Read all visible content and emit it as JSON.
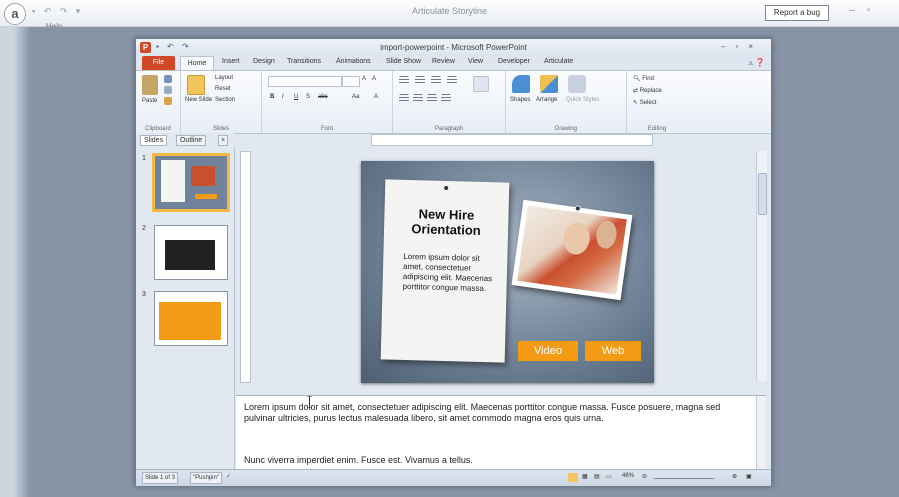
{
  "outer": {
    "title": "Articulate Storyline",
    "report_bug": "Report a bug",
    "help": "Help",
    "app_orb": "a"
  },
  "ppt": {
    "title": "import-powerpoint - Microsoft PowerPoint",
    "tabs": [
      "File",
      "Home",
      "Insert",
      "Design",
      "Transitions",
      "Animations",
      "Slide Show",
      "Review",
      "View",
      "Developer",
      "Articulate"
    ],
    "ribbon": {
      "clipboard": {
        "label": "Clipboard",
        "paste": "Paste"
      },
      "slides": {
        "label": "Slides",
        "new_slide": "New Slide",
        "layout": "Layout",
        "reset": "Reset",
        "section": "Section"
      },
      "font": {
        "label": "Font",
        "bold": "B",
        "italic": "I",
        "underline": "U",
        "strike": "S",
        "abc": "abc",
        "size_up": "A",
        "size_down": "A",
        "case": "Aa",
        "clear": "A"
      },
      "paragraph": {
        "label": "Paragraph"
      },
      "drawing": {
        "label": "Drawing",
        "shapes": "Shapes",
        "arrange": "Arrange",
        "quick_styles": "Quick Styles"
      },
      "editing": {
        "label": "Editing",
        "find": "Find",
        "replace": "Replace",
        "select": "Select"
      }
    },
    "panel_tabs": {
      "slides": "Slides",
      "outline": "Outline"
    },
    "thumbs": [
      "1",
      "2",
      "3"
    ],
    "slide": {
      "title_line1": "New Hire",
      "title_line2": "Orientation",
      "body": "Lorem ipsum dolor sit amet, consectetuer adipiscing elit. Maecenas porttitor congue massa.",
      "btn_video": "Video",
      "btn_web": "Web"
    },
    "notes": {
      "para1": "Lorem ipsum dolor sit amet, consectetuer adipiscing elit. Maecenas porttitor congue massa. Fusce posuere, magna sed pulvinar ultricies, purus lectus malesuada libero, sit amet commodo magna eros quis urna.",
      "para2": "Nunc viverra imperdiet enim. Fusce est. Vivamus a tellus."
    },
    "status": {
      "slide_of": "Slide 1 of 3",
      "theme": "\"Pushpin\"",
      "zoom": "46%"
    }
  },
  "colors": {
    "accent": "#d24726",
    "button": "#f49b16",
    "selected_thumb": "#f5b944"
  }
}
